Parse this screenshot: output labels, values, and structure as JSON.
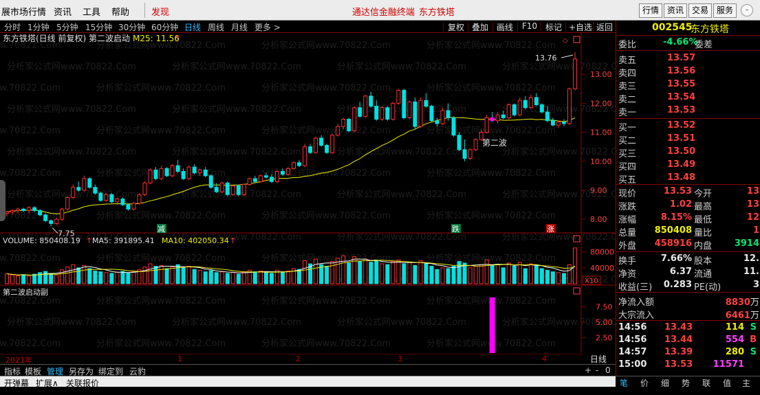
{
  "menubar": {
    "items": [
      "展市场行情",
      "资讯",
      "工具",
      "帮助"
    ],
    "highlight": "发现",
    "center_title": "通达信金融终端",
    "center_stock": "东方铁塔",
    "right_buttons": [
      "行情",
      "资讯",
      "交易",
      "服务"
    ]
  },
  "periods": [
    "分时",
    "1分钟",
    "5分钟",
    "15分钟",
    "30分钟",
    "60分钟",
    "日线",
    "周线",
    "月线",
    "更多 >"
  ],
  "active_period": "日线",
  "tools": [
    "复权",
    "叠加",
    "画线",
    "F10",
    "标记",
    "+自选",
    "返回"
  ],
  "chart": {
    "title": "东方铁塔(日线 前复权) 第二波启动",
    "ma_label": "M25: 11.56",
    "annotation_wave": "第二波",
    "high_label": "13.76",
    "low_label": "7.75",
    "tag_reduce": "减",
    "tag_fall": "跌",
    "tag_rise": "涨",
    "volume_label": "VOLUME: 850408.19",
    "ma5_label": "MA5: 391895.41",
    "ma10_label": "MA10: 402050.34",
    "x10_label": "X10",
    "sub_title": "第二波启动副",
    "watermark": "分析家公式网www.70822.Com",
    "time_axis": {
      "year": "2021年",
      "months": [
        "1",
        "2",
        "3",
        "4"
      ],
      "period_label": "日线"
    }
  },
  "chart_data": [
    {
      "type": "candlestick",
      "title": "东方铁塔(日线 前复权) 第二波启动",
      "ylim": [
        7.6,
        14.0
      ],
      "yticks": [
        8.0,
        9.0,
        10.0,
        11.0,
        12.0,
        13.0
      ],
      "series": [
        {
          "name": "M25",
          "last": 11.56
        }
      ],
      "candles": [
        [
          8.2,
          8.3,
          8.1,
          8.25
        ],
        [
          8.25,
          8.35,
          8.15,
          8.3
        ],
        [
          8.3,
          8.4,
          8.2,
          8.35
        ],
        [
          8.35,
          8.4,
          8.25,
          8.3
        ],
        [
          8.3,
          8.45,
          8.2,
          8.4
        ],
        [
          8.4,
          8.45,
          8.25,
          8.3
        ],
        [
          8.3,
          8.35,
          8.1,
          8.15
        ],
        [
          8.15,
          8.2,
          7.9,
          7.95
        ],
        [
          7.95,
          8.0,
          7.75,
          7.85
        ],
        [
          7.85,
          8.05,
          7.8,
          8.0
        ],
        [
          8.0,
          8.4,
          7.95,
          8.35
        ],
        [
          8.35,
          8.8,
          8.3,
          8.75
        ],
        [
          8.75,
          9.2,
          8.7,
          9.1
        ],
        [
          9.1,
          9.3,
          8.95,
          9.0
        ],
        [
          9.0,
          9.5,
          8.95,
          9.4
        ],
        [
          9.4,
          9.45,
          9.05,
          9.1
        ],
        [
          9.1,
          9.2,
          8.85,
          8.9
        ],
        [
          8.9,
          8.95,
          8.6,
          8.65
        ],
        [
          8.65,
          8.9,
          8.6,
          8.85
        ],
        [
          8.85,
          8.9,
          8.55,
          8.6
        ],
        [
          8.6,
          8.75,
          8.5,
          8.7
        ],
        [
          8.7,
          8.75,
          8.45,
          8.5
        ],
        [
          8.5,
          8.55,
          8.3,
          8.35
        ],
        [
          8.35,
          8.6,
          8.3,
          8.55
        ],
        [
          8.55,
          8.9,
          8.5,
          8.85
        ],
        [
          8.85,
          9.3,
          8.8,
          9.25
        ],
        [
          9.25,
          9.75,
          9.2,
          9.7
        ],
        [
          9.7,
          9.8,
          9.35,
          9.4
        ],
        [
          9.4,
          9.85,
          9.35,
          9.75
        ],
        [
          9.75,
          9.8,
          9.45,
          9.5
        ],
        [
          9.5,
          9.9,
          9.45,
          9.85
        ],
        [
          9.85,
          10.05,
          9.6,
          9.65
        ],
        [
          9.65,
          9.75,
          9.35,
          9.4
        ],
        [
          9.4,
          9.85,
          9.35,
          9.8
        ],
        [
          9.8,
          9.9,
          9.55,
          9.6
        ],
        [
          9.6,
          9.75,
          9.5,
          9.7
        ],
        [
          9.7,
          9.8,
          9.45,
          9.5
        ],
        [
          9.5,
          9.55,
          9.05,
          9.1
        ],
        [
          9.1,
          9.25,
          8.9,
          8.95
        ],
        [
          8.95,
          9.3,
          8.9,
          9.25
        ],
        [
          9.25,
          9.3,
          8.8,
          8.85
        ],
        [
          8.85,
          9.2,
          8.8,
          9.15
        ],
        [
          9.15,
          9.2,
          8.8,
          8.85
        ],
        [
          8.85,
          9.25,
          8.8,
          9.2
        ],
        [
          9.2,
          9.45,
          9.15,
          9.4
        ],
        [
          9.4,
          9.5,
          9.25,
          9.3
        ],
        [
          9.3,
          9.55,
          9.25,
          9.5
        ],
        [
          9.5,
          9.6,
          9.4,
          9.45
        ],
        [
          9.45,
          9.55,
          9.25,
          9.3
        ],
        [
          9.3,
          9.7,
          9.25,
          9.65
        ],
        [
          9.65,
          9.75,
          9.5,
          9.55
        ],
        [
          9.55,
          9.8,
          9.5,
          9.75
        ],
        [
          9.75,
          10.0,
          9.7,
          9.95
        ],
        [
          9.95,
          10.05,
          9.8,
          9.85
        ],
        [
          9.85,
          10.6,
          9.8,
          10.5
        ],
        [
          10.5,
          10.6,
          10.25,
          10.3
        ],
        [
          10.3,
          10.85,
          10.25,
          10.8
        ],
        [
          10.8,
          10.9,
          10.5,
          10.55
        ],
        [
          10.55,
          10.6,
          10.25,
          10.3
        ],
        [
          10.3,
          10.95,
          10.25,
          10.9
        ],
        [
          10.9,
          11.3,
          10.85,
          11.2
        ],
        [
          11.2,
          11.5,
          11.1,
          11.45
        ],
        [
          11.45,
          11.5,
          11.0,
          11.05
        ],
        [
          11.05,
          11.9,
          11.0,
          11.85
        ],
        [
          11.85,
          12.05,
          11.5,
          11.55
        ],
        [
          11.55,
          12.3,
          11.5,
          12.25
        ],
        [
          12.25,
          12.4,
          11.85,
          11.9
        ],
        [
          11.9,
          12.1,
          11.4,
          11.45
        ],
        [
          11.45,
          11.9,
          11.4,
          11.85
        ],
        [
          11.85,
          11.9,
          11.4,
          11.45
        ],
        [
          11.45,
          12.05,
          11.4,
          12.0
        ],
        [
          12.0,
          12.5,
          11.95,
          12.45
        ],
        [
          12.45,
          12.5,
          11.45,
          11.5
        ],
        [
          11.5,
          12.1,
          11.45,
          12.05
        ],
        [
          12.05,
          12.2,
          11.1,
          11.2
        ],
        [
          11.2,
          12.2,
          11.15,
          12.1
        ],
        [
          12.1,
          12.35,
          11.85,
          11.9
        ],
        [
          11.9,
          11.95,
          11.35,
          11.4
        ],
        [
          11.4,
          11.5,
          11.2,
          11.3
        ],
        [
          11.3,
          11.85,
          11.25,
          11.75
        ],
        [
          11.75,
          12.0,
          11.4,
          11.5
        ],
        [
          11.5,
          11.55,
          10.85,
          10.9
        ],
        [
          10.9,
          11.0,
          10.35,
          10.4
        ],
        [
          10.4,
          10.75,
          10.0,
          10.1
        ],
        [
          10.1,
          10.45,
          10.05,
          10.4
        ],
        [
          10.4,
          10.8,
          10.35,
          10.75
        ],
        [
          10.75,
          11.1,
          10.7,
          11.0
        ],
        [
          11.0,
          11.6,
          10.95,
          11.5
        ],
        [
          11.5,
          11.7,
          11.35,
          11.4
        ],
        [
          11.4,
          11.7,
          11.3,
          11.6
        ],
        [
          11.6,
          11.75,
          11.45,
          11.5
        ],
        [
          11.5,
          12.0,
          11.45,
          11.95
        ],
        [
          11.95,
          12.0,
          11.55,
          11.6
        ],
        [
          11.6,
          12.2,
          11.55,
          12.1
        ],
        [
          12.1,
          12.25,
          11.8,
          11.85
        ],
        [
          11.85,
          12.3,
          11.8,
          12.2
        ],
        [
          12.2,
          12.35,
          11.9,
          11.95
        ],
        [
          11.95,
          12.0,
          11.65,
          11.7
        ],
        [
          11.7,
          11.9,
          11.35,
          11.4
        ],
        [
          11.4,
          11.5,
          11.2,
          11.25
        ],
        [
          11.25,
          11.4,
          11.15,
          11.35
        ],
        [
          11.35,
          11.45,
          11.2,
          11.3
        ],
        [
          11.3,
          12.55,
          11.25,
          12.5
        ],
        [
          12.5,
          13.76,
          12.45,
          13.53
        ]
      ]
    },
    {
      "type": "bar",
      "title": "VOLUME",
      "series": [
        {
          "name": "VOLUME",
          "last": 850408.19
        },
        {
          "name": "MA5",
          "last": 391895.41
        },
        {
          "name": "MA10",
          "last": 402050.34
        }
      ],
      "ylim": [
        0,
        95000
      ],
      "yticks": [
        40000,
        80000
      ],
      "values": [
        25,
        22,
        20,
        23,
        19,
        24,
        28,
        31,
        26,
        22,
        35,
        42,
        48,
        40,
        46,
        38,
        32,
        30,
        28,
        26,
        29,
        31,
        27,
        30,
        35,
        42,
        50,
        44,
        46,
        38,
        42,
        48,
        40,
        44,
        36,
        34,
        30,
        33,
        28,
        30,
        26,
        28,
        24,
        30,
        34,
        30,
        32,
        28,
        26,
        34,
        30,
        32,
        38,
        36,
        58,
        50,
        62,
        48,
        44,
        56,
        64,
        70,
        52,
        68,
        56,
        62,
        54,
        58,
        50,
        48,
        56,
        60,
        50,
        54,
        46,
        58,
        50,
        44,
        36,
        40,
        38,
        44,
        56,
        52,
        40,
        44,
        48,
        60,
        46,
        48,
        40,
        52,
        44,
        54,
        38,
        50,
        46,
        38,
        34,
        30,
        28,
        26,
        48,
        90
      ]
    },
    {
      "type": "bar",
      "title": "第二波启动副",
      "ylim": [
        0,
        9.0
      ],
      "yticks": [
        2.5,
        5.0,
        7.5
      ],
      "signal_at_index": 88,
      "signal_value": 9.0
    }
  ],
  "quote": {
    "code": "002545",
    "name": "东方铁塔",
    "weibi_label": "委比",
    "weibi_value": "-4.66%",
    "weicha_label": "委差",
    "asks": [
      {
        "label": "卖五",
        "price": "13.57"
      },
      {
        "label": "卖四",
        "price": "13.56"
      },
      {
        "label": "卖三",
        "price": "13.55"
      },
      {
        "label": "卖二",
        "price": "13.54"
      },
      {
        "label": "卖一",
        "price": "13.53"
      }
    ],
    "bids": [
      {
        "label": "买一",
        "price": "13.52"
      },
      {
        "label": "买二",
        "price": "13.51"
      },
      {
        "label": "买三",
        "price": "13.50"
      },
      {
        "label": "买四",
        "price": "13.49"
      },
      {
        "label": "买五",
        "price": "13.48"
      }
    ],
    "stats": [
      {
        "l1": "现价",
        "v1": "13.53",
        "c1": "red",
        "l2": "今开",
        "v2": "13",
        "c2": "red"
      },
      {
        "l1": "涨跌",
        "v1": "1.02",
        "c1": "red",
        "l2": "最高",
        "v2": "13",
        "c2": "red"
      },
      {
        "l1": "涨幅",
        "v1": "8.15%",
        "c1": "red",
        "l2": "最低",
        "v2": "12",
        "c2": "red"
      },
      {
        "l1": "总量",
        "v1": "850408",
        "c1": "yellow",
        "l2": "量比",
        "v2": "1",
        "c2": "red"
      },
      {
        "l1": "外盘",
        "v1": "458916",
        "c1": "red",
        "l2": "内盘",
        "v2": "3914",
        "c2": "green"
      }
    ],
    "stats2": [
      {
        "l1": "换手",
        "v1": "7.66%",
        "c1": "white",
        "l2": "股本",
        "v2": "12.",
        "c2": "white"
      },
      {
        "l1": "净资",
        "v1": "6.37",
        "c1": "white",
        "l2": "流通",
        "v2": "11.",
        "c2": "white"
      },
      {
        "l1": "收益(三)",
        "v1": "0.283",
        "c1": "white",
        "l2": "PE(动)",
        "v2": "3",
        "c2": "white"
      }
    ],
    "flows": [
      {
        "label": "净流入额",
        "value": "8830",
        "unit": "万"
      },
      {
        "label": "大宗流入",
        "value": "6461",
        "unit": "万"
      }
    ],
    "ticks": [
      {
        "time": "14:56",
        "price": "13.43",
        "vol": "114",
        "vol_color": "yellow",
        "side": "S",
        "side_color": "green"
      },
      {
        "time": "14:56",
        "price": "13.44",
        "vol": "554",
        "vol_color": "magenta",
        "side": "B",
        "side_color": "red"
      },
      {
        "time": "14:57",
        "price": "13.39",
        "vol": "280",
        "vol_color": "yellow",
        "side": "S",
        "side_color": "green"
      },
      {
        "time": "15:00",
        "price": "13.53",
        "vol": "11571",
        "vol_color": "magenta",
        "side": "",
        "side_color": "red"
      }
    ]
  },
  "bottom_tabs": [
    "指标",
    "模板",
    "管理",
    "另存为",
    "绑定到",
    "云豹"
  ],
  "active_bottom_tab": "管理",
  "bottom_tabs2": [
    "开弹幕",
    "扩展∧",
    "关联报价"
  ],
  "rp_tabs": [
    "笔",
    "价",
    "细",
    "势",
    "联",
    "值",
    "主"
  ],
  "colors": {
    "up": "#ff3030",
    "down": "#00e0e0",
    "ma": "#f0f000",
    "signal": "#ff00ff",
    "grid": "#800000"
  }
}
